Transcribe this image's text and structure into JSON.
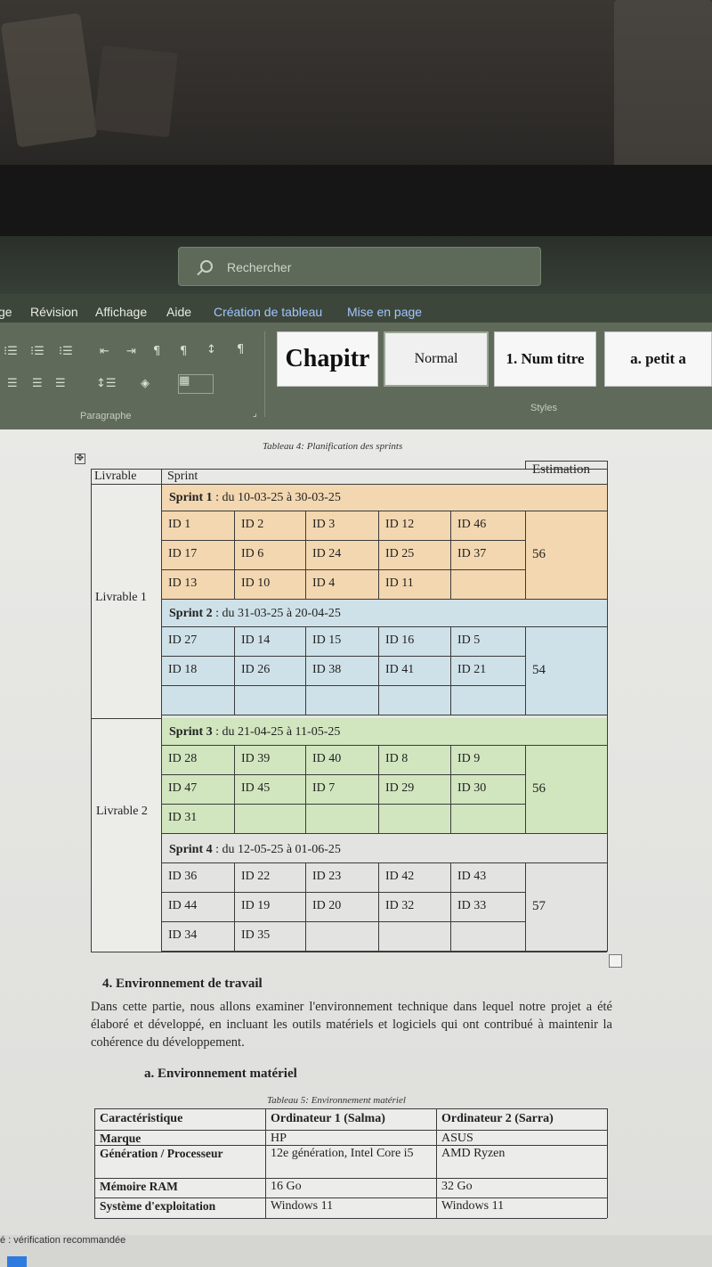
{
  "search": {
    "placeholder": "Rechercher"
  },
  "menu": [
    {
      "label": "ge",
      "x": 0
    },
    {
      "label": "Révision"
    },
    {
      "label": "Affichage"
    },
    {
      "label": "Aide"
    },
    {
      "label": "Création de tableau"
    },
    {
      "label": "Mise en page"
    }
  ],
  "ribbon": {
    "paragraph_label": "Paragraphe",
    "styles_label": "Styles",
    "styles": [
      "Chapitr",
      "Normal",
      "1. Num titre",
      "a. petit a"
    ]
  },
  "table4": {
    "caption": "Tableau 4: Planification des sprints",
    "headers": [
      "Livrable",
      "Sprint",
      "Estimation"
    ],
    "livrables": [
      "Livrable 1",
      "Livrable 2"
    ],
    "sprints": [
      {
        "title_bold": "Sprint 1",
        "title_rest": " : du 10-03-25 à 30-03-25",
        "color": "#f3d7b0",
        "rows": [
          [
            "ID 1",
            "ID 2",
            "ID 3",
            "ID 12",
            "ID 46"
          ],
          [
            "ID 17",
            "ID 6",
            "ID 24",
            "ID 25",
            "ID 37"
          ],
          [
            "ID 13",
            "ID 10",
            "ID 4",
            "ID 11",
            ""
          ]
        ],
        "estimation": "56"
      },
      {
        "title_bold": "Sprint 2",
        "title_rest": " : du 31-03-25 à 20-04-25",
        "color": "#cfe1e8",
        "rows": [
          [
            "ID 27",
            "ID 14",
            "ID 15",
            "ID 16",
            "ID 5"
          ],
          [
            "ID 18",
            "ID 26",
            "ID 38",
            "ID 41",
            "ID 21"
          ],
          [
            "",
            "",
            "",
            "",
            ""
          ]
        ],
        "estimation": "54"
      },
      {
        "title_bold": "Sprint 3",
        "title_rest": " : du 21-04-25 à 11-05-25",
        "color": "#d1e6bf",
        "rows": [
          [
            "ID 28",
            "ID 39",
            "ID 40",
            "ID 8",
            "ID 9"
          ],
          [
            "ID 47",
            "ID 45",
            "ID 7",
            "ID 29",
            "ID 30"
          ],
          [
            "ID 31",
            "",
            "",
            "",
            ""
          ]
        ],
        "estimation": "56"
      },
      {
        "title_bold": "Sprint 4",
        "title_rest": " : du 12-05-25 à 01-06-25",
        "color": "#e3e3e1",
        "rows": [
          [
            "ID 36",
            "ID 22",
            "ID 23",
            "ID 42",
            "ID 43"
          ],
          [
            "ID 44",
            "ID 19",
            "ID 20",
            "ID 32",
            "ID 33"
          ],
          [
            "ID 34",
            "ID 35",
            "",
            "",
            ""
          ]
        ],
        "estimation": "57"
      }
    ]
  },
  "section4": {
    "heading": "4.  Environnement de travail",
    "paragraph": "Dans cette partie, nous allons examiner l'environnement technique dans lequel notre projet a été élaboré et développé, en incluant les outils matériels et logiciels qui ont contribué à maintenir la cohérence du développement."
  },
  "subsection_a": {
    "heading": "a.  Environnement matériel"
  },
  "table5": {
    "caption": "Tableau 5: Environnement matériel",
    "headers": [
      "Caractéristique",
      "Ordinateur 1 (Salma)",
      "Ordinateur 2 (Sarra)"
    ],
    "rows": [
      [
        "Marque",
        "HP",
        "ASUS"
      ],
      [
        "Génération / Processeur",
        "12e génération, Intel Core i5",
        "AMD Ryzen"
      ],
      [
        "Mémoire RAM",
        "16 Go",
        "32 Go"
      ],
      [
        "Système d'exploitation",
        "Windows 11",
        "Windows 11"
      ]
    ]
  },
  "status": {
    "text": "é : vérification recommandée"
  }
}
